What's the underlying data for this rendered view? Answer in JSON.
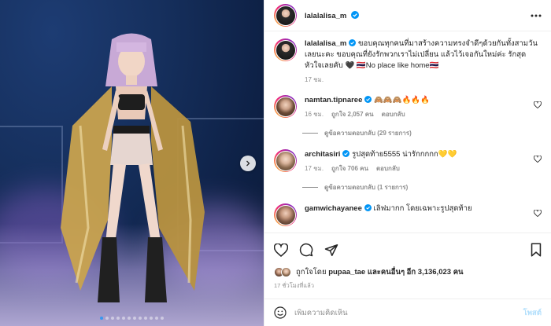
{
  "post": {
    "author": "lalalalisa_m",
    "caption_user": "lalalalisa_m",
    "caption_text": "ขอบคุณทุกคนที่มาสร้างความทรงจำดีๆด้วยกันทั้งสามวันเลยนะคะ ขอบคุณที่ยังรักพวกเราไม่เปลี่ยน แล้วไว้เจอกันใหม่ค่ะ รักสุดหัวใจเลยคับ 🖤 🇹🇭No place like home🇹🇭",
    "caption_time": "17 ชม."
  },
  "comments": [
    {
      "user": "namtan.tipnaree",
      "text": "🙈🙈🙈🔥🔥🔥",
      "time": "16 ชม.",
      "likes": "ถูกใจ 2,057 คน",
      "reply": "ตอบกลับ",
      "view_replies": "ดูข้อความตอบกลับ (29 รายการ)"
    },
    {
      "user": "architasiri",
      "text": "รูปสุดท้าย5555 น่ารักกกกก💛💛",
      "time": "17 ชม.",
      "likes": "ถูกใจ 706 คน",
      "reply": "ตอบกลับ",
      "view_replies": "ดูข้อความตอบกลับ (1 รายการ)"
    },
    {
      "user": "gamwichayanee",
      "text": "เลิฟมากก โดยเฉพาะรูปสุดท้าย"
    }
  ],
  "likes_line": {
    "prefix": "ถูกใจโดย",
    "user": "pupaa_tae",
    "middle": "และคนอื่นๆ อีก",
    "count": "3,136,023",
    "suffix": "คน"
  },
  "post_time": "17 ชั่วโมงที่แล้ว",
  "add_comment": {
    "placeholder": "เพิ่มความคิดเห็น",
    "post_label": "โพสต์"
  },
  "carousel": {
    "count": 12,
    "active_index": 0
  },
  "colors": {
    "verified": "#0095f6",
    "link": "#0095f6",
    "post_disabled": "#b2dffc"
  },
  "icons": [
    "verified-icon",
    "more-options-icon",
    "heart-icon",
    "comment-icon",
    "share-icon",
    "bookmark-icon",
    "emoji-icon",
    "chevron-right-icon"
  ]
}
